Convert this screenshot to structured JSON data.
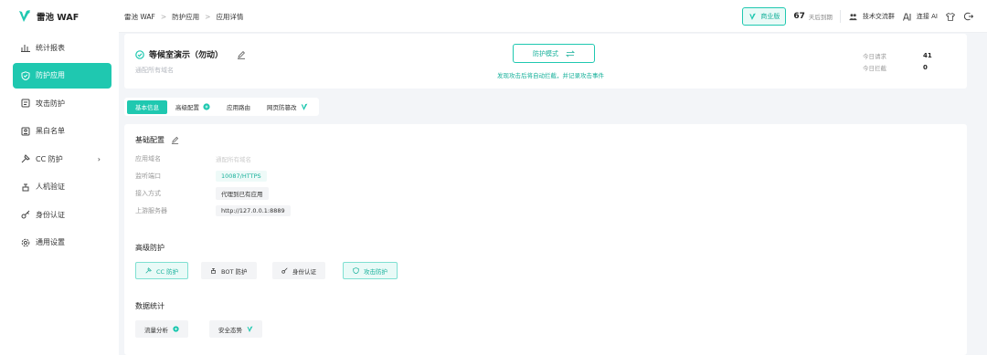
{
  "brand": {
    "name": "雷池 WAF"
  },
  "sidebar": {
    "items": [
      {
        "label": "统计报表",
        "icon": "bar-chart-icon",
        "active": false
      },
      {
        "label": "防护应用",
        "icon": "shield-icon",
        "active": true
      },
      {
        "label": "攻击防护",
        "icon": "attack-icon",
        "active": false
      },
      {
        "label": "黑白名单",
        "icon": "list-icon",
        "active": false
      },
      {
        "label": "CC 防护",
        "icon": "cc-icon",
        "active": false,
        "chevron": "›"
      },
      {
        "label": "人机验证",
        "icon": "robot-icon",
        "active": false
      },
      {
        "label": "身份认证",
        "icon": "key-icon",
        "active": false
      },
      {
        "label": "通用设置",
        "icon": "gear-icon",
        "active": false
      }
    ]
  },
  "breadcrumb": {
    "root": "雷池 WAF",
    "section": "防护应用",
    "current": "应用详情",
    "sep": ">"
  },
  "topbar": {
    "edition": "商业版",
    "days_num": "67",
    "days_label": "天后到期",
    "community": "技术交流群",
    "ai": "连接 AI"
  },
  "app": {
    "name": "等候室演示（勿动）",
    "subtitle": "通配所有域名",
    "mode_button": "防护模式",
    "mode_hint": "发现攻击后将自动拦截，并记录攻击事件",
    "stats": [
      {
        "label": "今日请求",
        "value": "41"
      },
      {
        "label": "今日拦截",
        "value": "0"
      }
    ]
  },
  "tabs": [
    {
      "label": "基本信息",
      "active": true
    },
    {
      "label": "高级配置",
      "active": false
    },
    {
      "label": "应用路由",
      "active": false
    },
    {
      "label": "网页防篡改",
      "active": false
    }
  ],
  "basic": {
    "title": "基础配置",
    "fields": [
      {
        "label": "应用域名",
        "value": "通配所有域名"
      },
      {
        "label": "监听端口",
        "value": "10087/HTTPS"
      },
      {
        "label": "接入方式",
        "value": "代理到已有应用"
      },
      {
        "label": "上游服务器",
        "value": "http://127.0.0.1:8889"
      }
    ]
  },
  "advanced": {
    "title": "高级防护",
    "items": [
      "CC 防护",
      "BOT 防护",
      "身份认证",
      "攻击防护"
    ]
  },
  "datastats": {
    "title": "数据统计",
    "items": [
      "流量分析",
      "安全态势"
    ]
  },
  "colors": {
    "accent": "#1fc8b0",
    "accent_text": "#16b09a"
  }
}
